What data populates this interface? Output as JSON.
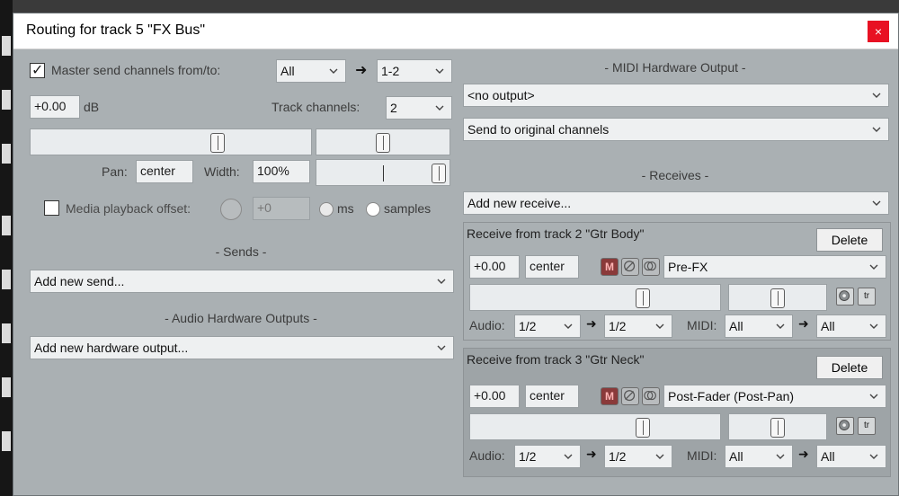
{
  "window": {
    "title": "Routing for track 5 \"FX Bus\"",
    "close_glyph": "×"
  },
  "master": {
    "send_label": "Master send channels from/to:",
    "send_from": "All",
    "send_to": "1-2",
    "volume": "+0.00",
    "db_unit": "dB",
    "track_channels_label": "Track channels:",
    "track_channels": "2",
    "pan_label": "Pan:",
    "pan": "center",
    "width_label": "Width:",
    "width": "100%",
    "media_offset_label": "Media playback offset:",
    "media_offset_value": "+0",
    "unit_ms": "ms",
    "unit_samples": "samples"
  },
  "sends": {
    "header": "- Sends -",
    "add_send": "Add new send..."
  },
  "hw_outputs": {
    "header": "- Audio Hardware Outputs -",
    "add_output": "Add new hardware output..."
  },
  "midi_hw": {
    "header": "- MIDI Hardware Output -",
    "output": "<no output>",
    "channels": "Send to original channels"
  },
  "receives": {
    "header": "- Receives -",
    "add_receive": "Add new receive...",
    "delete_label": "Delete",
    "items": [
      {
        "title": "Receive from track 2 \"Gtr Body\"",
        "volume": "+0.00",
        "pan": "center",
        "mute": "M",
        "mode": "Pre-FX",
        "audio_label": "Audio:",
        "audio_from": "1/2",
        "audio_to": "1/2",
        "midi_label": "MIDI:",
        "midi_from": "All",
        "midi_to": "All"
      },
      {
        "title": "Receive from track 3 \"Gtr Neck\"",
        "volume": "+0.00",
        "pan": "center",
        "mute": "M",
        "mode": "Post-Fader (Post-Pan)",
        "audio_label": "Audio:",
        "audio_from": "1/2",
        "audio_to": "1/2",
        "midi_label": "MIDI:",
        "midi_from": "All",
        "midi_to": "All"
      }
    ]
  },
  "icons": {
    "checkmark": "✓",
    "arrow": "➜",
    "chevron": "chevron-down-icon",
    "env": "envelope-icon",
    "tr": "tr"
  }
}
